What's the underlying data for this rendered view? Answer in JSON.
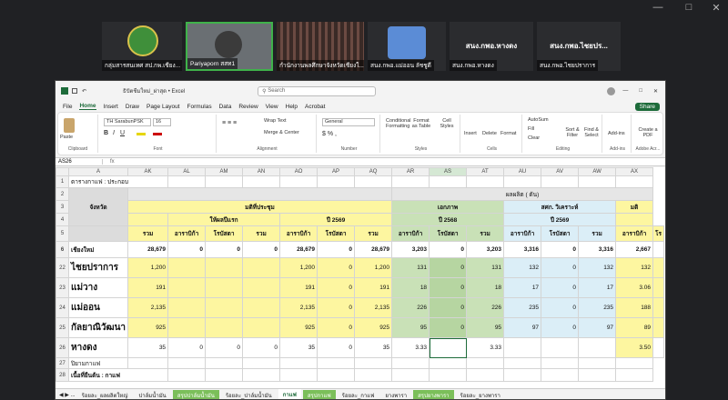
{
  "meeting": {
    "participants": [
      {
        "name": "กลุ่มสารสนเทศ สป.กพ.เชียง...",
        "kind": "logo"
      },
      {
        "name": "Pariyaporn สสท1",
        "kind": "video"
      },
      {
        "name": "กำนักงานพลศึกษาจังหวัดเชียงใ...",
        "kind": "video"
      },
      {
        "name": "สนง.กพอ.แม่ออน ลัชชูดี",
        "kind": "avatar"
      },
      {
        "name": "สนง.กพอ.หางดง",
        "kind": "text",
        "label": "สนง.กพอ.หางดง"
      },
      {
        "name": "สนง.กพอ.ไชยปราการ",
        "kind": "text",
        "label": "สนง.กพอ.ไชยปร..."
      }
    ]
  },
  "excel": {
    "filename": "ธิปัตชีมใหม่_ผ่าสุด • Excel",
    "search_placeholder": "Search",
    "menu": [
      "File",
      "Home",
      "Insert",
      "Draw",
      "Page Layout",
      "Formulas",
      "Data",
      "Review",
      "View",
      "Help",
      "Acrobat"
    ],
    "active_menu": "Home",
    "share_label": "Share",
    "ribbon": {
      "font_name": "TH SarabunPSK",
      "font_size": "16",
      "number_format": "General",
      "wrap": "Wrap Text",
      "merge": "Merge & Center",
      "groups": [
        "Clipboard",
        "Font",
        "Alignment",
        "Number",
        "Styles",
        "Cells",
        "Editing",
        "Add-ins",
        "Adobe Acr..."
      ],
      "buttons": [
        "Paste",
        "Conditional Formatting",
        "Format as Table",
        "Cell Styles",
        "Insert",
        "Delete",
        "Format",
        "AutoSum",
        "Fill",
        "Clear",
        "Sort & Filter",
        "Find & Select",
        "Add-ins",
        "Create a PDF"
      ]
    },
    "name_box": "AS26",
    "col_headers": [
      "A",
      "AK",
      "AL",
      "AM",
      "AN",
      "AO",
      "AP",
      "AQ",
      "AR",
      "AS",
      "AT",
      "AU",
      "AV",
      "AW",
      "AX"
    ],
    "row1": "ตารางกาแฟ : ประกอบ",
    "row2": "ผลผลิต ( ตัน)",
    "row3": {
      "province": "จังหวัด",
      "a": "มติที่ประชุม",
      "b": "เอกภาพ",
      "c": "สศก. วิเคราะห์",
      "d": "มติ"
    },
    "row4": {
      "a": "ให้ผลปีแรก",
      "b": "ปี 2569",
      "c": "ปี 2568",
      "d": "ปี 2569"
    },
    "row5": [
      "รวม",
      "อาราบิก้า",
      "โรบัสตา",
      "รวม",
      "อาราบิก้า",
      "โรบัสตา",
      "รวม",
      "อาราบิก้า",
      "โรบัสตา",
      "รวม",
      "อาราบิก้า",
      "โรบัสตา",
      "รวม",
      "อาราบิก้า",
      "โร"
    ],
    "rows": [
      {
        "n": "6",
        "name": "เชียงใหม่",
        "v": [
          "28,679",
          "0",
          "0",
          "0",
          "28,679",
          "0",
          "28,679",
          "3,203",
          "0",
          "3,203",
          "3,316",
          "0",
          "3,316",
          "2,667",
          ""
        ]
      },
      {
        "n": "22",
        "name": "ไชยปราการ",
        "v": [
          "1,200",
          "",
          "",
          "",
          "1,200",
          "0",
          "1,200",
          "131",
          "0",
          "131",
          "132",
          "0",
          "132",
          "132",
          ""
        ]
      },
      {
        "n": "23",
        "name": "แม่วาง",
        "v": [
          "191",
          "",
          "",
          "",
          "191",
          "0",
          "191",
          "18",
          "0",
          "18",
          "17",
          "0",
          "17",
          "3.06",
          ""
        ]
      },
      {
        "n": "24",
        "name": "แม่ออน",
        "v": [
          "2,135",
          "",
          "",
          "",
          "2,135",
          "0",
          "2,135",
          "226",
          "0",
          "226",
          "235",
          "0",
          "235",
          "188",
          ""
        ]
      },
      {
        "n": "25",
        "name": "กัลยาณิวัฒนา",
        "v": [
          "925",
          "",
          "",
          "",
          "925",
          "0",
          "925",
          "95",
          "0",
          "95",
          "97",
          "0",
          "97",
          "89",
          ""
        ]
      },
      {
        "n": "26",
        "name": "หางดง",
        "v": [
          "35",
          "0",
          "0",
          "0",
          "35",
          "0",
          "35",
          "3.33",
          "",
          "3.33",
          "",
          "",
          "",
          "3.50",
          ""
        ]
      }
    ],
    "row27": "ปิยามกาแฟ",
    "row28": "เนื้อที่ยืนต้น : กาแฟ",
    "sheet_tabs": [
      "ร้อยละ_ผลผลิตใหญ่",
      "ปาล์มน้ำมัน",
      "สรุปปาล์มน้ำมัน",
      "ร้อยละ_ปาล์มน้ำมัน",
      "กาแฟ",
      "สรุปกาแฟ",
      "ร้อยละ_กาแฟ",
      "ยางพารา",
      "สรุปยางพารา",
      "ร้อยละ_ยางพารา"
    ],
    "active_tab": "กาแฟ"
  }
}
